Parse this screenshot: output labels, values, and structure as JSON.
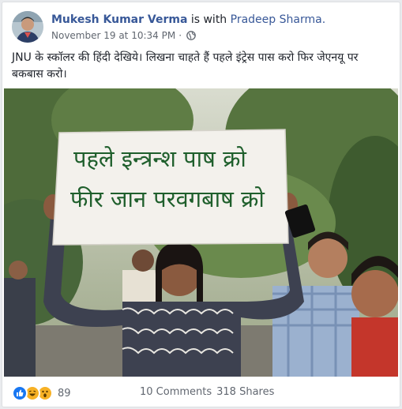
{
  "post": {
    "author": "Mukesh Kumar Verma",
    "with_text": "is with",
    "tagged": "Pradeep Sharma.",
    "timestamp": "November 19 at 10:34 PM",
    "separator": "·",
    "audience_icon": "globe-icon",
    "text": "JNU के स्कॉलर की हिंदी देखिये। लिखना चाहते हैं पहले इंट्रेस पास करो फिर जेएनयू पर बकबास करो।"
  },
  "photo": {
    "sign_line_1": "पहले इन्त्रन्श पाष क्रो",
    "sign_line_2": "फीर जान परवगबाष क्रो"
  },
  "footer": {
    "reactions": [
      "like-icon",
      "haha-icon",
      "wow-icon"
    ],
    "reaction_count": "89",
    "comments": "10 Comments",
    "shares": "318 Shares"
  },
  "colors": {
    "link": "#385898",
    "text": "#1d2129",
    "meta": "#616770",
    "like": "#1877f2",
    "haha": "#f7b125"
  }
}
